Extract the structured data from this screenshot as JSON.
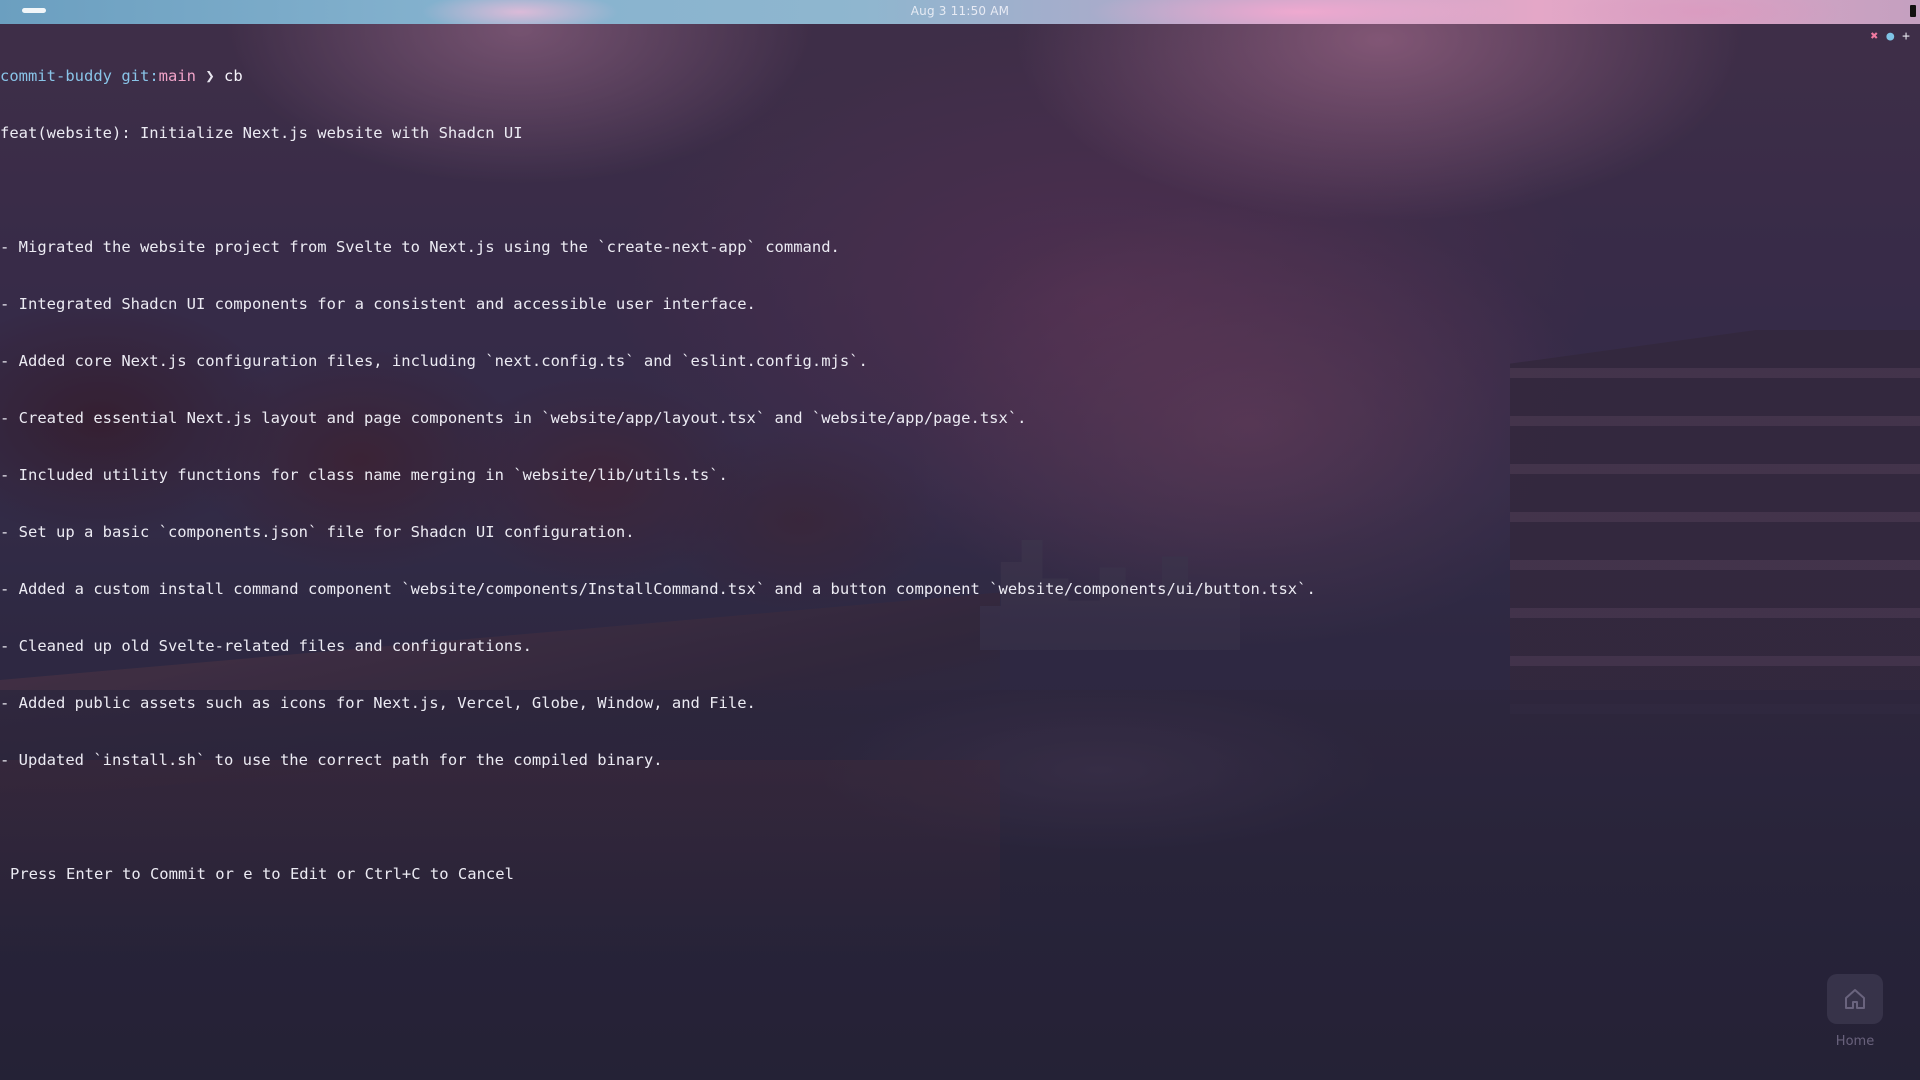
{
  "topbar": {
    "clock": "Aug 3  11:50 AM"
  },
  "terminal": {
    "prompt": {
      "dir": "commit-buddy",
      "git_label": "git:",
      "branch": "main",
      "arrow": "❯",
      "command": "cb"
    },
    "commit_title": "feat(website): Initialize Next.js website with Shadcn UI",
    "commit_body": [
      "- Migrated the website project from Svelte to Next.js using the `create-next-app` command.",
      "- Integrated Shadcn UI components for a consistent and accessible user interface.",
      "- Added core Next.js configuration files, including `next.config.ts` and `eslint.config.mjs`.",
      "- Created essential Next.js layout and page components in `website/app/layout.tsx` and `website/app/page.tsx`.",
      "- Included utility functions for class name merging in `website/lib/utils.ts`.",
      "- Set up a basic `components.json` file for Shadcn UI configuration.",
      "- Added a custom install command component `website/components/InstallCommand.tsx` and a button component `website/components/ui/button.tsx`.",
      "- Cleaned up old Svelte-related files and configurations.",
      "- Added public assets such as icons for Next.js, Vercel, Globe, Window, and File.",
      "- Updated `install.sh` to use the correct path for the compiled binary."
    ],
    "hint": "Press Enter to Commit or e to Edit or Ctrl+C to Cancel",
    "controls": {
      "close_glyph": "✖",
      "dot_glyph": "●",
      "plus_glyph": "+"
    }
  },
  "desktop": {
    "home_label": "Home",
    "home_icon": "home-icon"
  },
  "colors": {
    "prompt_dir": "#89c4e8",
    "prompt_branch": "#f0a3c8",
    "text": "#e8e6ef",
    "close": "#f07aa0"
  }
}
